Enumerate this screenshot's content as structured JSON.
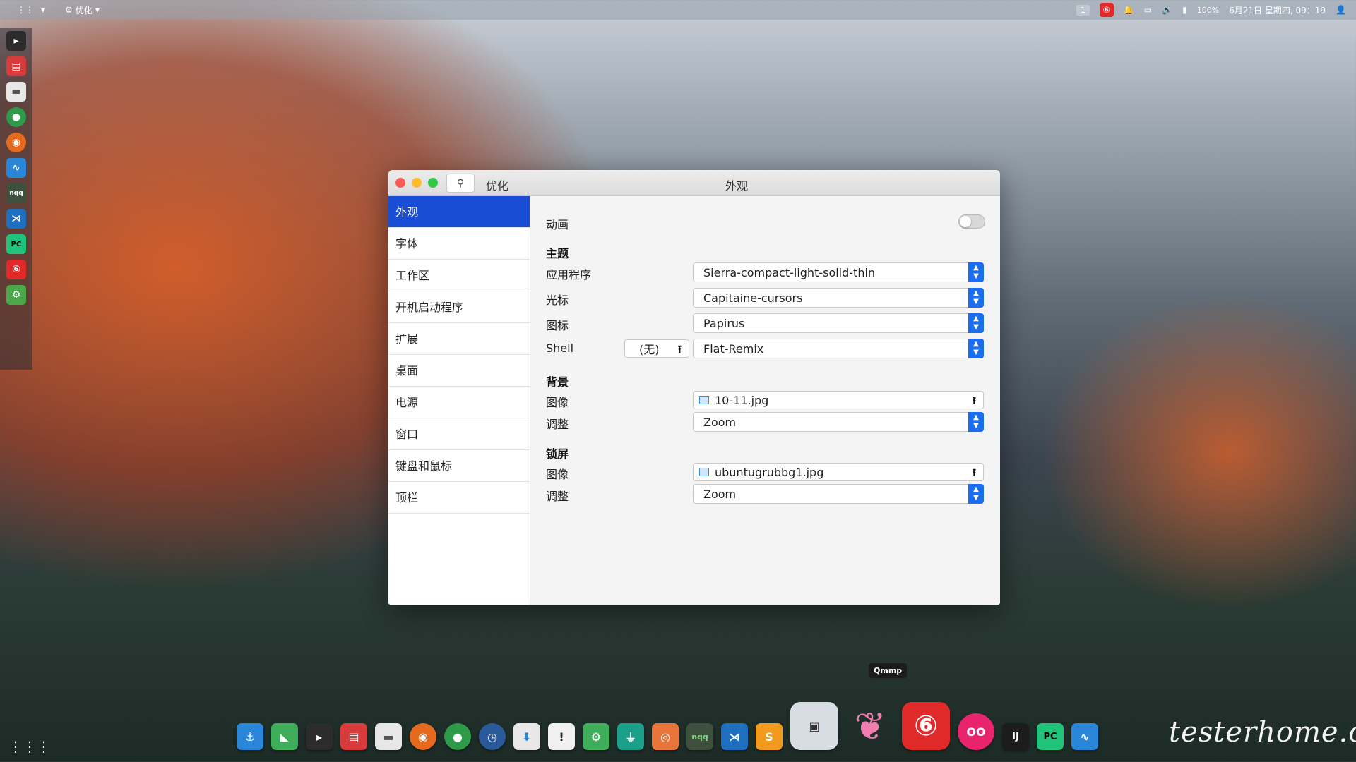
{
  "top_panel": {
    "app_label": "优化",
    "workspace": "1",
    "netease_glyph": "⑥",
    "battery": "100%",
    "datetime": "6月21日 星期四, 09：19"
  },
  "window": {
    "app_title": "优化",
    "section_title": "外观"
  },
  "sidebar": {
    "items": [
      {
        "label": "外观"
      },
      {
        "label": "字体"
      },
      {
        "label": "工作区"
      },
      {
        "label": "开机启动程序"
      },
      {
        "label": "扩展"
      },
      {
        "label": "桌面"
      },
      {
        "label": "电源"
      },
      {
        "label": "窗口"
      },
      {
        "label": "键盘和鼠标"
      },
      {
        "label": "顶栏"
      }
    ],
    "active_index": 0
  },
  "content": {
    "animation_label": "动画",
    "animation_enabled": false,
    "theme_heading": "主题",
    "applications_label": "应用程序",
    "applications_value": "Sierra-compact-light-solid-thin",
    "cursor_label": "光标",
    "cursor_value": "Capitaine-cursors",
    "icons_label": "图标",
    "icons_value": "Papirus",
    "shell_label": "Shell",
    "shell_file": "(无)",
    "shell_value": "Flat-Remix",
    "background_heading": "背景",
    "bg_image_label": "图像",
    "bg_image_value": "10-11.jpg",
    "bg_adjust_label": "调整",
    "bg_adjust_value": "Zoom",
    "lock_heading": "锁屏",
    "lock_image_label": "图像",
    "lock_image_value": "ubuntugrubbg1.jpg",
    "lock_adjust_label": "调整",
    "lock_adjust_value": "Zoom"
  },
  "dock": {
    "tooltip": "Qmmp",
    "nqq_label": "nqq",
    "ij_label": "IJ",
    "pc_label": "PC"
  },
  "watermark": "testerhome.com"
}
